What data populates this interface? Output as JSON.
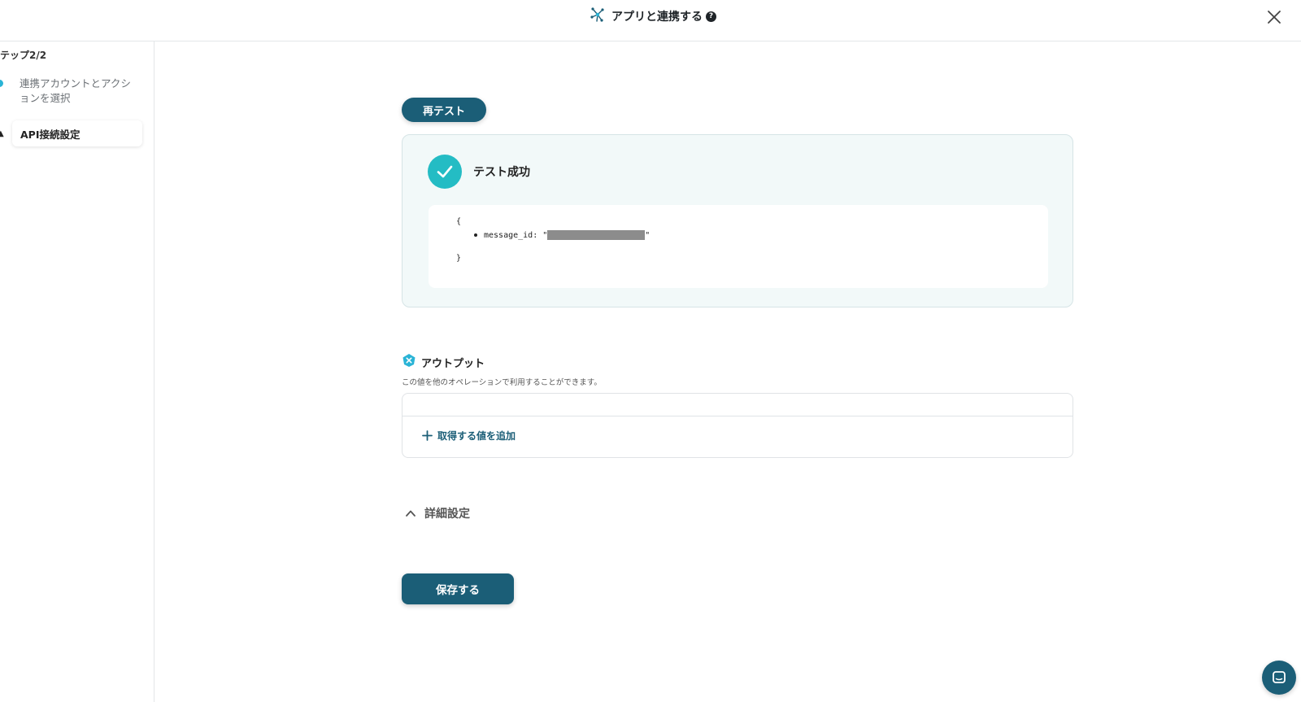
{
  "header": {
    "title": "アプリと連携する",
    "help_icon": "question-circle-icon",
    "close_icon": "close-icon"
  },
  "sidebar": {
    "step_label": "テップ2/2",
    "items": [
      {
        "label": "連携アカウントとアクションを選択",
        "state": "done"
      },
      {
        "label": "API接続設定",
        "state": "active"
      }
    ]
  },
  "main": {
    "retest_label": "再テスト",
    "result": {
      "status": "テスト成功",
      "json_open": "{",
      "json_key": "message_id: \"",
      "json_quote_end": "\"",
      "json_close": "}"
    },
    "output": {
      "title": "アウトプット",
      "description": "この値を他のオペレーションで利用することができます。",
      "add_value_label": "取得する値を追加"
    },
    "advanced_label": "詳細設定",
    "save_label": "保存する"
  },
  "colors": {
    "primary": "#1b5e77",
    "success": "#24bcc4",
    "step_dot": "#2ab4d6",
    "result_bg": "#f2f9f9"
  }
}
